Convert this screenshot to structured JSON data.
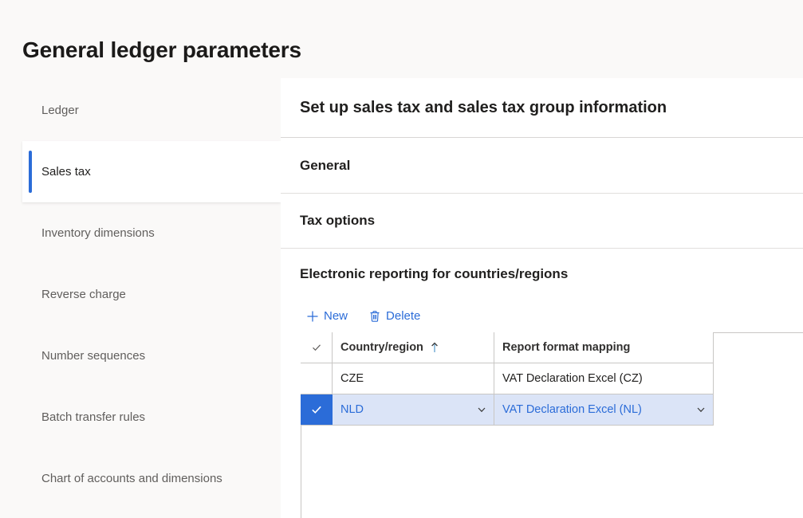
{
  "page": {
    "title": "General ledger parameters"
  },
  "sidebar": {
    "items": [
      {
        "label": "Ledger",
        "selected": false
      },
      {
        "label": "Sales tax",
        "selected": true
      },
      {
        "label": "Inventory dimensions",
        "selected": false
      },
      {
        "label": "Reverse charge",
        "selected": false
      },
      {
        "label": "Number sequences",
        "selected": false
      },
      {
        "label": "Batch transfer rules",
        "selected": false
      },
      {
        "label": "Chart of accounts and dimensions",
        "selected": false
      }
    ]
  },
  "main": {
    "header": "Set up sales tax and sales tax group information",
    "sections": [
      {
        "title": "General"
      },
      {
        "title": "Tax options"
      },
      {
        "title": "Electronic reporting for countries/regions"
      }
    ],
    "toolbar": {
      "new_label": "New",
      "new_icon": "plus-icon",
      "delete_label": "Delete",
      "delete_icon": "trash-icon"
    },
    "grid": {
      "select_all_icon": "checkmark-icon",
      "sort_indicator": "sort-ascending-arrow-icon",
      "columns": [
        {
          "key": "check",
          "header": ""
        },
        {
          "key": "country",
          "header": "Country/region",
          "sorted": "ascending"
        },
        {
          "key": "format",
          "header": "Report format mapping"
        }
      ],
      "rows": [
        {
          "selected": false,
          "country": "CZE",
          "format": "VAT Declaration Excel (CZ)"
        },
        {
          "selected": true,
          "country": "NLD",
          "format": "VAT Declaration Excel (NL)"
        }
      ]
    }
  },
  "colors": {
    "accent": "#2b6cd8",
    "selected_row_bg": "#dbe4f7",
    "page_bg": "#faf9f8",
    "panel_bg": "#ffffff",
    "border": "#c8c6c4",
    "sort_arrow": "#7fb3d9"
  }
}
